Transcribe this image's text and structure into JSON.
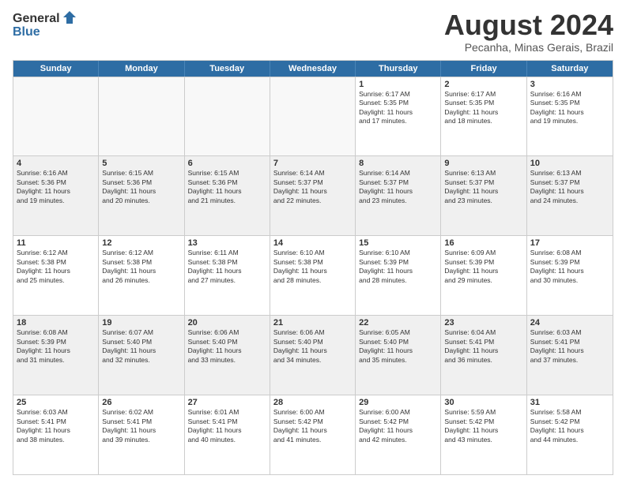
{
  "logo": {
    "general": "General",
    "blue": "Blue"
  },
  "header": {
    "month": "August 2024",
    "location": "Pecanha, Minas Gerais, Brazil"
  },
  "weekdays": [
    "Sunday",
    "Monday",
    "Tuesday",
    "Wednesday",
    "Thursday",
    "Friday",
    "Saturday"
  ],
  "rows": [
    [
      {
        "day": "",
        "text": "",
        "empty": true
      },
      {
        "day": "",
        "text": "",
        "empty": true
      },
      {
        "day": "",
        "text": "",
        "empty": true
      },
      {
        "day": "",
        "text": "",
        "empty": true
      },
      {
        "day": "1",
        "text": "Sunrise: 6:17 AM\nSunset: 5:35 PM\nDaylight: 11 hours\nand 17 minutes.",
        "empty": false
      },
      {
        "day": "2",
        "text": "Sunrise: 6:17 AM\nSunset: 5:35 PM\nDaylight: 11 hours\nand 18 minutes.",
        "empty": false
      },
      {
        "day": "3",
        "text": "Sunrise: 6:16 AM\nSunset: 5:35 PM\nDaylight: 11 hours\nand 19 minutes.",
        "empty": false
      }
    ],
    [
      {
        "day": "4",
        "text": "Sunrise: 6:16 AM\nSunset: 5:36 PM\nDaylight: 11 hours\nand 19 minutes.",
        "empty": false
      },
      {
        "day": "5",
        "text": "Sunrise: 6:15 AM\nSunset: 5:36 PM\nDaylight: 11 hours\nand 20 minutes.",
        "empty": false
      },
      {
        "day": "6",
        "text": "Sunrise: 6:15 AM\nSunset: 5:36 PM\nDaylight: 11 hours\nand 21 minutes.",
        "empty": false
      },
      {
        "day": "7",
        "text": "Sunrise: 6:14 AM\nSunset: 5:37 PM\nDaylight: 11 hours\nand 22 minutes.",
        "empty": false
      },
      {
        "day": "8",
        "text": "Sunrise: 6:14 AM\nSunset: 5:37 PM\nDaylight: 11 hours\nand 23 minutes.",
        "empty": false
      },
      {
        "day": "9",
        "text": "Sunrise: 6:13 AM\nSunset: 5:37 PM\nDaylight: 11 hours\nand 23 minutes.",
        "empty": false
      },
      {
        "day": "10",
        "text": "Sunrise: 6:13 AM\nSunset: 5:37 PM\nDaylight: 11 hours\nand 24 minutes.",
        "empty": false
      }
    ],
    [
      {
        "day": "11",
        "text": "Sunrise: 6:12 AM\nSunset: 5:38 PM\nDaylight: 11 hours\nand 25 minutes.",
        "empty": false
      },
      {
        "day": "12",
        "text": "Sunrise: 6:12 AM\nSunset: 5:38 PM\nDaylight: 11 hours\nand 26 minutes.",
        "empty": false
      },
      {
        "day": "13",
        "text": "Sunrise: 6:11 AM\nSunset: 5:38 PM\nDaylight: 11 hours\nand 27 minutes.",
        "empty": false
      },
      {
        "day": "14",
        "text": "Sunrise: 6:10 AM\nSunset: 5:38 PM\nDaylight: 11 hours\nand 28 minutes.",
        "empty": false
      },
      {
        "day": "15",
        "text": "Sunrise: 6:10 AM\nSunset: 5:39 PM\nDaylight: 11 hours\nand 28 minutes.",
        "empty": false
      },
      {
        "day": "16",
        "text": "Sunrise: 6:09 AM\nSunset: 5:39 PM\nDaylight: 11 hours\nand 29 minutes.",
        "empty": false
      },
      {
        "day": "17",
        "text": "Sunrise: 6:08 AM\nSunset: 5:39 PM\nDaylight: 11 hours\nand 30 minutes.",
        "empty": false
      }
    ],
    [
      {
        "day": "18",
        "text": "Sunrise: 6:08 AM\nSunset: 5:39 PM\nDaylight: 11 hours\nand 31 minutes.",
        "empty": false
      },
      {
        "day": "19",
        "text": "Sunrise: 6:07 AM\nSunset: 5:40 PM\nDaylight: 11 hours\nand 32 minutes.",
        "empty": false
      },
      {
        "day": "20",
        "text": "Sunrise: 6:06 AM\nSunset: 5:40 PM\nDaylight: 11 hours\nand 33 minutes.",
        "empty": false
      },
      {
        "day": "21",
        "text": "Sunrise: 6:06 AM\nSunset: 5:40 PM\nDaylight: 11 hours\nand 34 minutes.",
        "empty": false
      },
      {
        "day": "22",
        "text": "Sunrise: 6:05 AM\nSunset: 5:40 PM\nDaylight: 11 hours\nand 35 minutes.",
        "empty": false
      },
      {
        "day": "23",
        "text": "Sunrise: 6:04 AM\nSunset: 5:41 PM\nDaylight: 11 hours\nand 36 minutes.",
        "empty": false
      },
      {
        "day": "24",
        "text": "Sunrise: 6:03 AM\nSunset: 5:41 PM\nDaylight: 11 hours\nand 37 minutes.",
        "empty": false
      }
    ],
    [
      {
        "day": "25",
        "text": "Sunrise: 6:03 AM\nSunset: 5:41 PM\nDaylight: 11 hours\nand 38 minutes.",
        "empty": false
      },
      {
        "day": "26",
        "text": "Sunrise: 6:02 AM\nSunset: 5:41 PM\nDaylight: 11 hours\nand 39 minutes.",
        "empty": false
      },
      {
        "day": "27",
        "text": "Sunrise: 6:01 AM\nSunset: 5:41 PM\nDaylight: 11 hours\nand 40 minutes.",
        "empty": false
      },
      {
        "day": "28",
        "text": "Sunrise: 6:00 AM\nSunset: 5:42 PM\nDaylight: 11 hours\nand 41 minutes.",
        "empty": false
      },
      {
        "day": "29",
        "text": "Sunrise: 6:00 AM\nSunset: 5:42 PM\nDaylight: 11 hours\nand 42 minutes.",
        "empty": false
      },
      {
        "day": "30",
        "text": "Sunrise: 5:59 AM\nSunset: 5:42 PM\nDaylight: 11 hours\nand 43 minutes.",
        "empty": false
      },
      {
        "day": "31",
        "text": "Sunrise: 5:58 AM\nSunset: 5:42 PM\nDaylight: 11 hours\nand 44 minutes.",
        "empty": false
      }
    ]
  ]
}
